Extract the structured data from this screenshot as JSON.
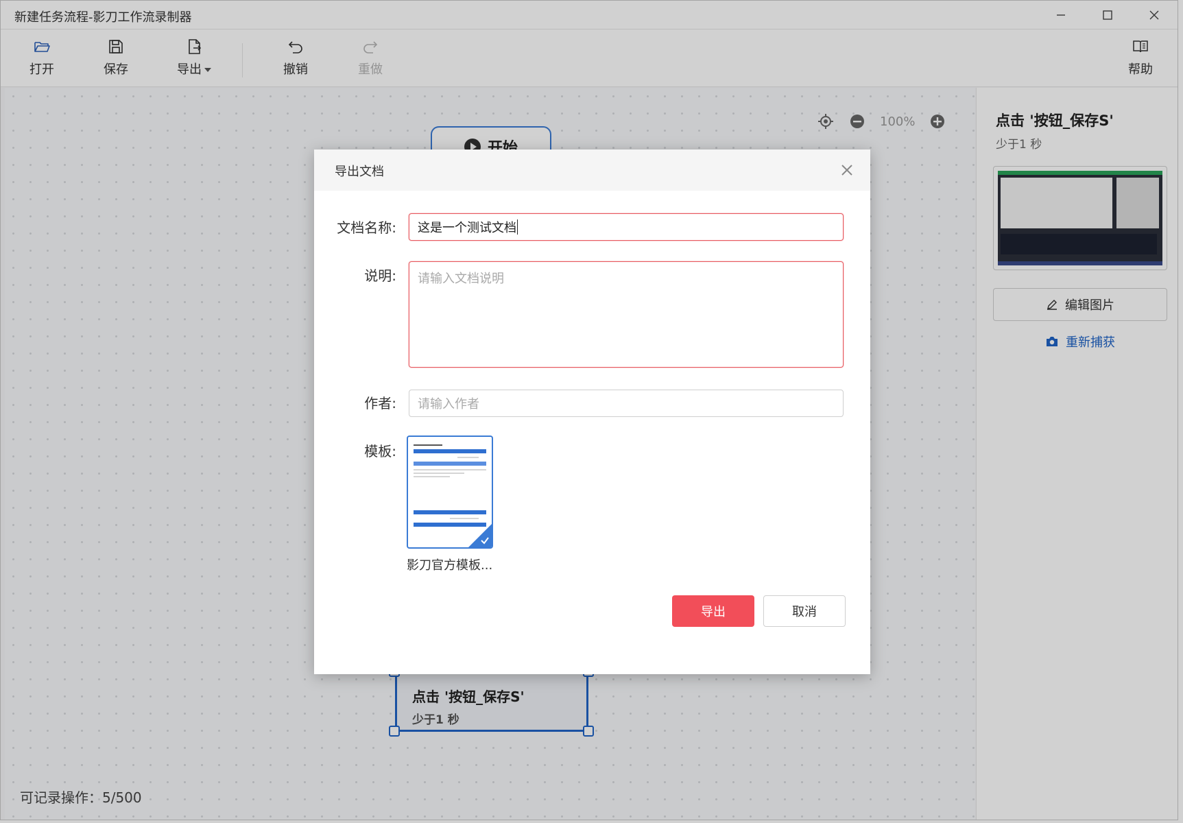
{
  "window": {
    "title": "新建任务流程-影刀工作流录制器"
  },
  "toolbar": {
    "open_label": "打开",
    "save_label": "保存",
    "export_label": "导出",
    "undo_label": "撤销",
    "redo_label": "重做",
    "help_label": "帮助"
  },
  "canvas": {
    "zoom": "100%",
    "start_label": "开始",
    "action_node": {
      "title": "点击 '按钮_保存S'",
      "subtitle": "少于1 秒"
    },
    "record_count": "可记录操作：5/500"
  },
  "side_panel": {
    "title": "点击 '按钮_保存S'",
    "subtitle": "少于1 秒",
    "edit_image_label": "编辑图片",
    "recapture_label": "重新捕获"
  },
  "dialog": {
    "title": "导出文档",
    "name_label": "文档名称:",
    "name_value": "这是一个测试文档",
    "desc_label": "说明:",
    "desc_placeholder": "请输入文档说明",
    "author_label": "作者:",
    "author_placeholder": "请输入作者",
    "template_label": "模板:",
    "template_name": "影刀官方模板...",
    "export_button": "导出",
    "cancel_button": "取消"
  },
  "colors": {
    "primary": "#f24e59",
    "accent_blue": "#1f63c6",
    "error_border": "#e85c62"
  }
}
